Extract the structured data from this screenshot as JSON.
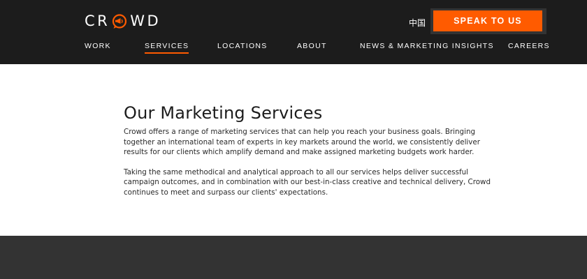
{
  "header": {
    "logo_text_left": "CR",
    "logo_text_right": "WD",
    "lang_link": "中国",
    "cta_label": "SPEAK TO US",
    "nav": [
      {
        "label": "WORK"
      },
      {
        "label": "SERVICES",
        "active": true
      },
      {
        "label": "LOCATIONS"
      },
      {
        "label": "ABOUT"
      },
      {
        "label": "NEWS & MARKETING INSIGHTS"
      },
      {
        "label": "CAREERS"
      }
    ]
  },
  "main": {
    "title": "Our Marketing Services",
    "paragraphs": [
      "Crowd offers a range of marketing services that can help you reach your business goals. Bringing together an international team of experts in key markets around the world, we consistently deliver results for our clients which amplify demand and make assigned marketing budgets work harder.",
      "Taking the same methodical and analytical approach to all our services helps deliver successful campaign outcomes, and in combination with our best-in-class creative and technical delivery, Crowd continues to meet and surpass our clients' expectations."
    ]
  },
  "colors": {
    "header_bg": "#1c1c1c",
    "accent": "#ff5b00",
    "footer_bg": "#333333"
  },
  "icons": {
    "logo_mark": "megaphone-speech-bubble-icon"
  }
}
